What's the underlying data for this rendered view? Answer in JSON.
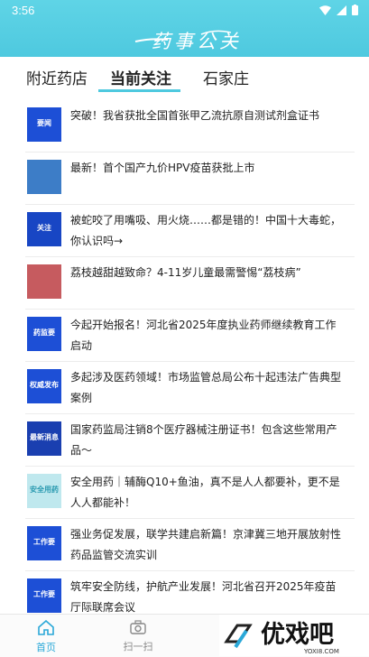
{
  "status_bar": {
    "time": "3:56"
  },
  "header": {
    "logo_text": "药事公关"
  },
  "tabs": [
    {
      "label": "附近药店"
    },
    {
      "label": "当前关注",
      "active": true
    },
    {
      "label": "石家庄"
    }
  ],
  "articles": [
    {
      "title": "突破！我省获批全国首张甲乙流抗原自测试剂盒证书",
      "thumb_text": "要闻",
      "thumb_color": "#1d4fd6"
    },
    {
      "title": "最新！首个国产九价HPV疫苗获批上市",
      "thumb_text": "",
      "thumb_color": "#3d7dc7"
    },
    {
      "title": "被蛇咬了用嘴吸、用火烧……都是错的！中国十大毒蛇，你认识吗→",
      "thumb_text": "关注",
      "thumb_color": "#1846c4"
    },
    {
      "title": "荔枝越甜越致命？4-11岁儿童最需警惕“荔枝病”",
      "thumb_text": "",
      "thumb_color": "#c65b5f"
    },
    {
      "title": "今起开始报名！河北省2025年度执业药师继续教育工作启动",
      "thumb_text": "药监要",
      "thumb_color": "#1d4fd6"
    },
    {
      "title": "多起涉及医药领域！市场监管总局公布十起违法广告典型案例",
      "thumb_text": "权威发布",
      "thumb_color": "#1d4fd6"
    },
    {
      "title": "国家药监局注销8个医疗器械注册证书！包含这些常用产品～",
      "thumb_text": "最新消息",
      "thumb_color": "#1a3fb0"
    },
    {
      "title": "安全用药｜辅酶Q10+鱼油，真不是人人都要补，更不是人人都能补！",
      "thumb_text": "安全用药",
      "thumb_color": "#bfe8ee"
    },
    {
      "title": "强业务促发展，联学共建启新篇！京津冀三地开展放射性药品监管交流实训",
      "thumb_text": "工作要",
      "thumb_color": "#1d4fd6"
    },
    {
      "title": "筑牢安全防线，护航产业发展！河北省召开2025年疫苗厅际联席会议",
      "thumb_text": "工作要",
      "thumb_color": "#1d4fd6"
    }
  ],
  "bottom_nav": [
    {
      "label": "首页",
      "icon": "home-icon",
      "active": true
    },
    {
      "label": "扫一扫",
      "icon": "camera-icon",
      "active": false
    },
    {
      "label": "我",
      "icon": "user-icon",
      "active": false
    }
  ],
  "watermark": {
    "text": "优戏吧",
    "sub": "YOXI8.COM"
  },
  "colors": {
    "accent": "#4ec9df",
    "nav_active": "#2aa8d8"
  }
}
